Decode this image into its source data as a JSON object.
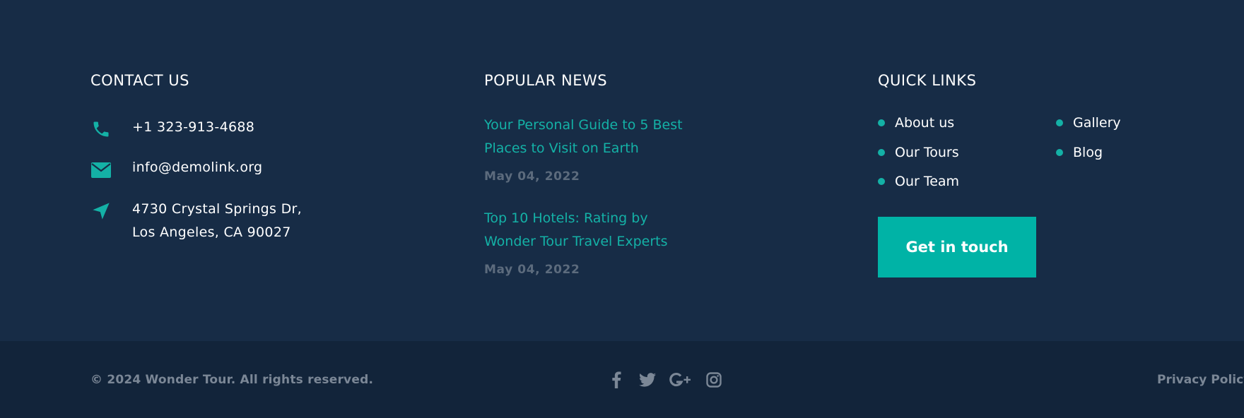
{
  "colors": {
    "background": "#172c46",
    "bottom_bar": "#12243a",
    "accent": "#14b1a6",
    "text": "#ffffff",
    "muted": "#7b8796"
  },
  "contact": {
    "heading": "CONTACT US",
    "phone": "+1 323-913-4688",
    "email": "info@demolink.org",
    "address_line1": "4730 Crystal Springs Dr,",
    "address_line2": "Los Angeles, CA 90027",
    "icons": [
      "phone-icon",
      "envelope-icon",
      "location-arrow-icon"
    ]
  },
  "news": {
    "heading": "POPULAR NEWS",
    "items": [
      {
        "title_line1": "Your Personal Guide to 5 Best",
        "title_line2": "Places to Visit on Earth",
        "date": "May 04, 2022"
      },
      {
        "title_line1": "Top 10 Hotels: Rating by",
        "title_line2": "Wonder Tour Travel Experts",
        "date": "May 04, 2022"
      }
    ]
  },
  "quick_links": {
    "heading": "QUICK LINKS",
    "left": [
      "About us",
      "Our Tours",
      "Our Team"
    ],
    "right": [
      "Gallery",
      "Blog"
    ],
    "cta_label": "Get in touch"
  },
  "bottom": {
    "copyright": "© 2024 Wonder Tour. All rights reserved.",
    "socials": [
      "facebook-icon",
      "twitter-icon",
      "google-plus-icon",
      "instagram-icon"
    ],
    "privacy": "Privacy Policy"
  }
}
